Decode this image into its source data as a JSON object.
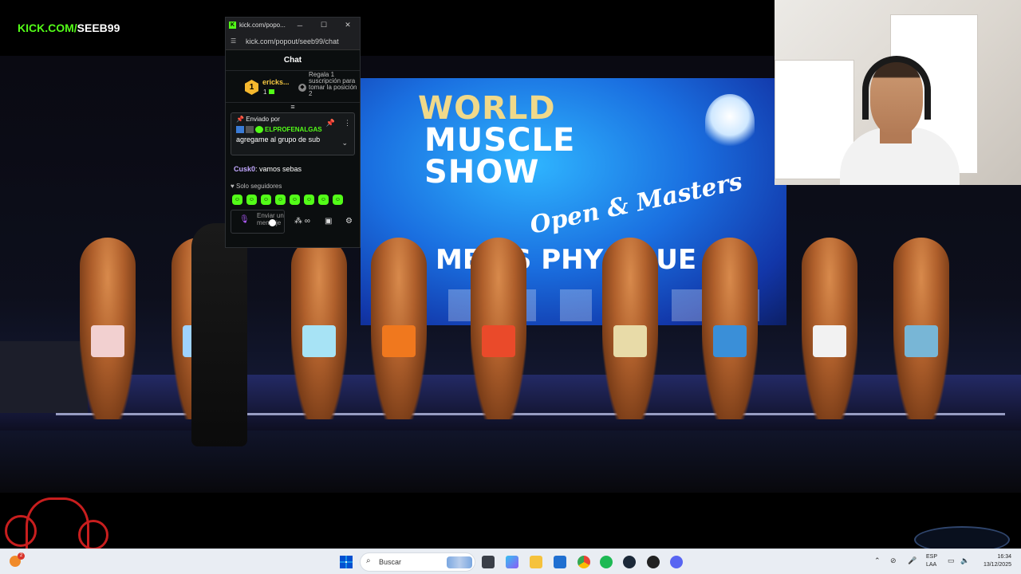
{
  "overlay": {
    "brand_prefix": "KICK.COM/",
    "brand_suffix": "SEEB99"
  },
  "stream": {
    "screen_line1": "WORLD",
    "screen_line2": "MUSCLE",
    "screen_line3": "SHOW",
    "screen_line4": "Open & Masters",
    "screen_line5": "MEN'S PHYSIQUE"
  },
  "chat_window": {
    "title": "kick.com/popo...",
    "url": "kick.com/popout/seeb99/chat",
    "header": "Chat",
    "leaderboard": {
      "rank": "1",
      "name": "ericks...",
      "count": "1",
      "gift_text": "Regala 1 suscripción para tomar la posición 2"
    },
    "pinned": {
      "sent_by": "Enviado por",
      "user": "ELPROFENALGAS",
      "message": "agregame al grupo de sub"
    },
    "messages": [
      {
        "user": "Cusk0",
        "text": "vamos sebas"
      }
    ],
    "followers_only": "Solo seguidores",
    "input_placeholder": "Enviar un mensaje"
  },
  "taskbar": {
    "weather_badge": "2",
    "search_placeholder": "Buscar",
    "lang_line1": "ESP",
    "lang_line2": "LAA",
    "time": "16:34",
    "date": "13/12/2025"
  },
  "colors": {
    "kick_green": "#53fc18",
    "leader_gold": "#f5b82e",
    "stage_screen": "#1a6fe0"
  },
  "icons": {
    "window_controls": [
      "minimize-icon",
      "maximize-icon",
      "close-icon"
    ],
    "chat_tools": [
      "mic-icon",
      "emoji-icon",
      "tools-icon",
      "gift-icon",
      "gear-icon"
    ]
  }
}
